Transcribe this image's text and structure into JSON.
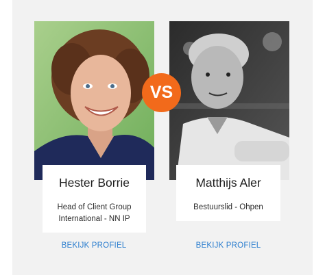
{
  "versus_label": "VS",
  "colors": {
    "panel_bg": "#f2f2f2",
    "vs_badge": "#f26a1b",
    "link": "#2e7fcf"
  },
  "left_person": {
    "name": "Hester Borrie",
    "role": "Head of Client Group International - NN IP",
    "link_label": "BEKIJK PROFIEL",
    "photo": "portrait-photo-color"
  },
  "right_person": {
    "name": "Matthijs Aler",
    "role": "Bestuurslid - Ohpen",
    "link_label": "BEKIJK PROFIEL",
    "photo": "portrait-photo-bw"
  }
}
